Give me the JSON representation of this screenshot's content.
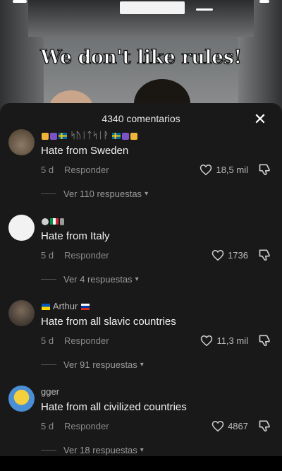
{
  "video": {
    "overlay_text": "We don't like rules!"
  },
  "comments_sheet": {
    "title": "4340 comentarios",
    "close_icon": "close-icon",
    "comments": [
      {
        "username": "ᛋᚢᛁᛏᛋᛁᚹ",
        "text": "Hate from Sweden",
        "time": "5 d",
        "reply_label": "Responder",
        "likes": "18,5 mil",
        "replies_label": "Ver 110 respuestas",
        "avatar_color": "#6b5a4a"
      },
      {
        "username": "",
        "text": "Hate from Italy",
        "time": "5 d",
        "reply_label": "Responder",
        "likes": "1736",
        "replies_label": "Ver 4 respuestas",
        "avatar_color": "#f2f2f2"
      },
      {
        "username": "Arthur",
        "text": "Hate from all slavic countries",
        "time": "5 d",
        "reply_label": "Responder",
        "likes": "11,3 mil",
        "replies_label": "Ver 91 respuestas",
        "avatar_color": "#3a3a3a"
      },
      {
        "username": "gger",
        "text": "Hate from all civilized countries",
        "time": "5 d",
        "reply_label": "Responder",
        "likes": "4867",
        "replies_label": "Ver 18 respuestas",
        "avatar_color": "#4a8fd6"
      }
    ]
  },
  "colors": {
    "sheet_bg": "#191919",
    "text_primary": "#f2f2f2",
    "text_secondary": "#8a8a8a"
  }
}
